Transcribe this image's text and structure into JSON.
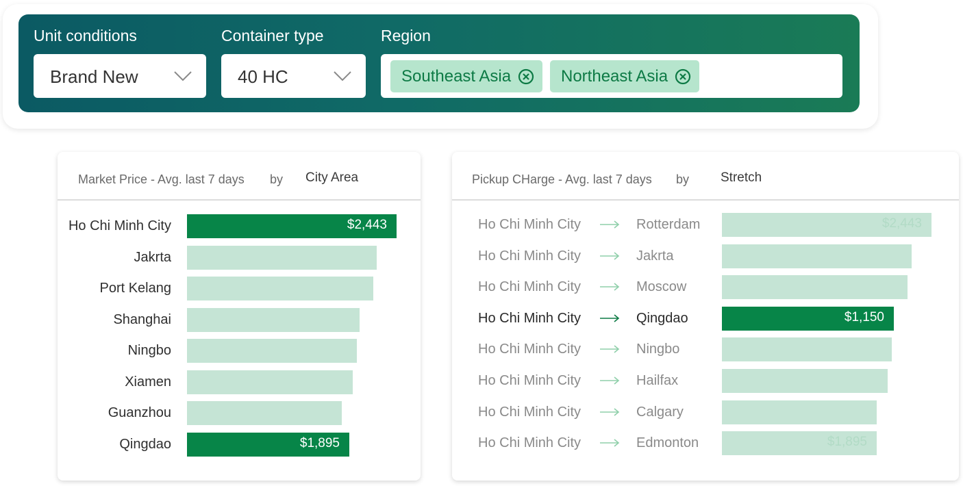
{
  "filters": {
    "unit_conditions": {
      "label": "Unit conditions",
      "value": "Brand New"
    },
    "container_type": {
      "label": "Container type",
      "value": "40 HC"
    },
    "region": {
      "label": "Region",
      "chips": [
        "Southeast Asia",
        "Northeast Asia"
      ]
    }
  },
  "market_price": {
    "title": "Market Price - Avg. last 7 days",
    "by": "by",
    "dimension": "City Area",
    "rows": [
      {
        "city": "Ho Chi Minh City",
        "value": 2443,
        "label": "$2,443",
        "highlight": true
      },
      {
        "city": "Jakrta",
        "value": 2210,
        "label": "",
        "highlight": false
      },
      {
        "city": "Port Kelang",
        "value": 2170,
        "label": "",
        "highlight": false
      },
      {
        "city": "Shanghai",
        "value": 2010,
        "label": "",
        "highlight": false
      },
      {
        "city": "Ningbo",
        "value": 1980,
        "label": "",
        "highlight": false
      },
      {
        "city": "Xiamen",
        "value": 1935,
        "label": "",
        "highlight": false
      },
      {
        "city": "Guanzhou",
        "value": 1805,
        "label": "",
        "highlight": false
      },
      {
        "city": "Qingdao",
        "value": 1895,
        "label": "$1,895",
        "highlight": true
      }
    ],
    "max": 2443
  },
  "pickup_charge": {
    "title": "Pickup CHarge - Avg. last 7 days",
    "by": "by",
    "dimension": "Stretch",
    "rows": [
      {
        "origin": "Ho Chi Minh City",
        "dest": "Rotterdam",
        "value": 1400,
        "label": "$2,443",
        "highlight": false
      },
      {
        "origin": "Ho Chi Minh City",
        "dest": "Jakrta",
        "value": 1268,
        "label": "",
        "highlight": false
      },
      {
        "origin": "Ho Chi Minh City",
        "dest": "Moscow",
        "value": 1242,
        "label": "",
        "highlight": false
      },
      {
        "origin": "Ho Chi Minh City",
        "dest": "Qingdao",
        "value": 1150,
        "label": "$1,150",
        "highlight": true
      },
      {
        "origin": "Ho Chi Minh City",
        "dest": "Ningbo",
        "value": 1134,
        "label": "",
        "highlight": false
      },
      {
        "origin": "Ho Chi Minh City",
        "dest": "Hailfax",
        "value": 1108,
        "label": "",
        "highlight": false
      },
      {
        "origin": "Ho Chi Minh City",
        "dest": "Calgary",
        "value": 1036,
        "label": "",
        "highlight": false
      },
      {
        "origin": "Ho Chi Minh City",
        "dest": "Edmonton",
        "value": 1036,
        "label": "$1,895",
        "highlight": false
      }
    ],
    "max": 1400
  },
  "colors": {
    "bar_highlight": "#078548",
    "bar_default": "#c5e4d5",
    "chip_bg": "#b6e5cd",
    "chip_text": "#0d7a45",
    "header_gradient_start": "#0b5a63",
    "header_gradient_end": "#1a7b56"
  }
}
